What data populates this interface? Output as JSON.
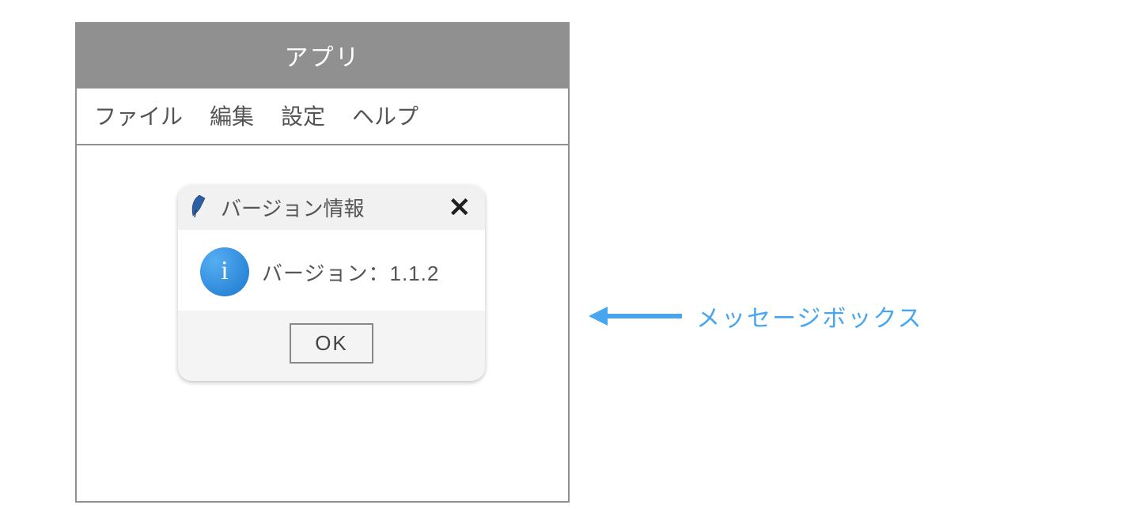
{
  "window": {
    "title": "アプリ",
    "menu": [
      "ファイル",
      "編集",
      "設定",
      "ヘルプ"
    ]
  },
  "msgbox": {
    "title": "バージョン情報",
    "message": "バージョン：1.1.2",
    "ok_label": "OK"
  },
  "annotation": {
    "label": "メッセージボックス",
    "color": "#47a6ef"
  }
}
